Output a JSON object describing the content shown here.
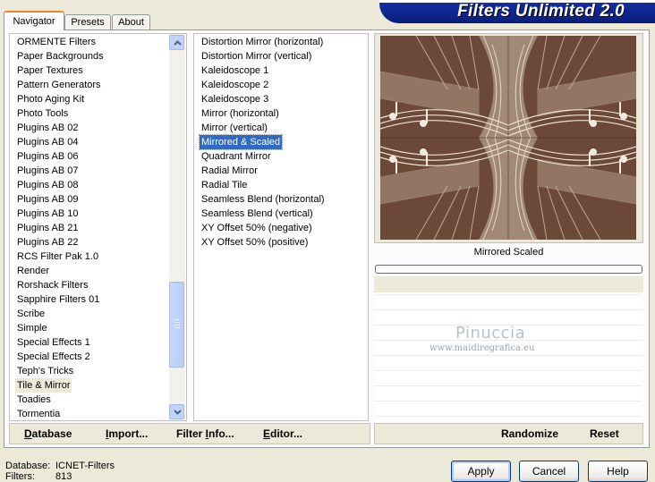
{
  "app": {
    "title": "Filters Unlimited 2.0"
  },
  "tabs": [
    {
      "label": "Navigator",
      "active": true
    },
    {
      "label": "Presets",
      "active": false
    },
    {
      "label": "About",
      "active": false
    }
  ],
  "categories": {
    "items": [
      "ORMENTE Filters",
      "Paper Backgrounds",
      "Paper Textures",
      "Pattern Generators",
      "Photo Aging Kit",
      "Photo Tools",
      "Plugins AB 02",
      "Plugins AB 04",
      "Plugins AB 06",
      "Plugins AB 07",
      "Plugins AB 08",
      "Plugins AB 09",
      "Plugins AB 10",
      "Plugins AB 21",
      "Plugins AB 22",
      "RCS Filter Pak 1.0",
      "Render",
      "Rorshack Filters",
      "Sapphire Filters 01",
      "Scribe",
      "Simple",
      "Special Effects 1",
      "Special Effects 2",
      "Teph's Tricks",
      "Tile & Mirror",
      "Toadies",
      "Tormentia"
    ],
    "selected": "Tile & Mirror"
  },
  "filters": {
    "items": [
      "Distortion Mirror (horizontal)",
      "Distortion Mirror (vertical)",
      "Kaleidoscope 1",
      "Kaleidoscope 2",
      "Kaleidoscope 3",
      "Mirror (horizontal)",
      "Mirror (vertical)",
      "Mirrored & Scaled",
      "Quadrant Mirror",
      "Radial Mirror",
      "Radial Tile",
      "Seamless Blend (horizontal)",
      "Seamless Blend (vertical)",
      "XY Offset 50% (negative)",
      "XY Offset 50% (positive)"
    ],
    "selected": "Mirrored & Scaled"
  },
  "preview": {
    "caption": "Mirrored  Scaled",
    "progress": 0
  },
  "watermark": {
    "name": "Pinuccia",
    "url": "www.maidiregrafica.eu"
  },
  "left_buttons": {
    "database": {
      "label": "atabase",
      "key": "D"
    },
    "import": {
      "label": "mport...",
      "key": "I",
      "prefix": ""
    },
    "filter_info": {
      "label": "Filter ",
      "key": "I",
      "suffix": "nfo..."
    },
    "editor": {
      "label": "ditor...",
      "key": "E"
    }
  },
  "right_buttons": {
    "randomize": "Randomize",
    "reset": "Reset"
  },
  "status": {
    "database_label": "Database:",
    "database_value": "ICNET-Filters",
    "filters_label": "Filters:",
    "filters_value": "813"
  },
  "dialog_buttons": {
    "apply": "Apply",
    "cancel": "Cancel",
    "help": "Help"
  },
  "colors": {
    "title_bar": "#0a1d7a",
    "selection": "#316ac5",
    "preview_bg": "#6b4837"
  }
}
